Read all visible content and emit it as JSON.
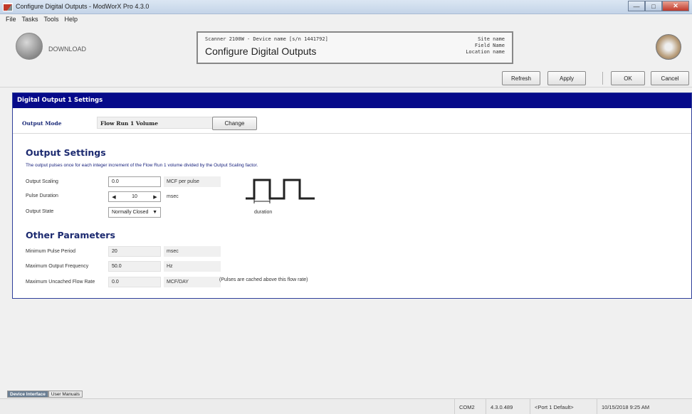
{
  "window": {
    "title": "Configure Digital Outputs - ModWorX Pro 4.3.0"
  },
  "menu": [
    {
      "label": "File"
    },
    {
      "label": "Tasks"
    },
    {
      "label": "Tools"
    },
    {
      "label": "Help"
    }
  ],
  "header": {
    "download_label": "DOWNLOAD",
    "device_line": "Scanner 2100W - Device name [s/n 1441792]",
    "page_title": "Configure Digital Outputs",
    "site_name": "Site name",
    "field_name": "Field Name",
    "location_name": "Location name"
  },
  "toolbar": {
    "refresh": "Refresh",
    "apply": "Apply",
    "ok": "OK",
    "cancel": "Cancel"
  },
  "panel": {
    "title": "Digital Output 1 Settings",
    "output_mode_label": "Output Mode",
    "output_mode_value": "Flow Run 1 Volume",
    "change_button": "Change"
  },
  "output_settings": {
    "title": "Output Settings",
    "description": "The output pulses once for each integer increment of the Flow Run 1 volume divided by the Output Scaling factor.",
    "scaling_label": "Output Scaling",
    "scaling_value": "0.0",
    "scaling_unit": "MCF per pulse",
    "pulse_label": "Pulse Duration",
    "pulse_value": "10",
    "pulse_unit": "msec",
    "state_label": "Output State",
    "state_value": "Normally Closed",
    "duration_label": "duration"
  },
  "other_parameters": {
    "title": "Other Parameters",
    "min_period_label": "Minimum Pulse Period",
    "min_period_value": "20",
    "min_period_unit": "msec",
    "max_freq_label": "Maximum Output Frequency",
    "max_freq_value": "50.0",
    "max_freq_unit": "Hz",
    "max_uncached_label": "Maximum Uncached Flow Rate",
    "max_uncached_value": "0.0",
    "max_uncached_unit": "MCF/DAY",
    "note": "(Pulses are cached above this flow rate)"
  },
  "bottom_tabs": [
    {
      "label": "Device Interface"
    },
    {
      "label": "User Manuals"
    }
  ],
  "status": {
    "port": "COM2",
    "version": "4.3.0.489",
    "profile": "<Port 1 Default>",
    "timestamp": "10/15/2018 9:25 AM"
  },
  "colors": {
    "panel_header": "#060a8a",
    "section_title": "#1c2a70",
    "description_text": "#1a237e"
  }
}
